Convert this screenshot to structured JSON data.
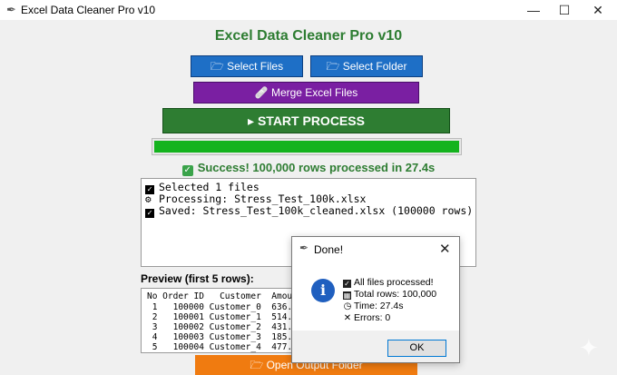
{
  "window": {
    "title": "Excel Data Cleaner Pro v10",
    "minimize_glyph": "—",
    "maximize_glyph": "☐",
    "close_glyph": "✕"
  },
  "app": {
    "heading": "Excel Data Cleaner Pro v10",
    "select_files_label": "🗁 Select Files",
    "select_folder_label": "🗁 Select Folder",
    "merge_label": "🩹 Merge Excel Files",
    "start_label": "▸ START PROCESS",
    "progress_percent": 100,
    "status_text": "Success! 100,000 rows processed in 27.4s",
    "log": [
      "Selected 1 files",
      "Processing: Stress_Test_100k.xlsx",
      "Saved: Stress_Test_100k_cleaned.xlsx (100000 rows)"
    ],
    "preview_label": "Preview (first 5 rows):",
    "preview_header": "No Order ID   Customer  Amount",
    "preview_rows": [
      " 1   100000 Customer_0  636.32",
      " 2   100001 Customer_1  514.47",
      " 3   100002 Customer_2  431.98",
      " 4   100003 Customer_3  185.15",
      " 5   100004 Customer_4  477.51"
    ],
    "open_output_label": "🗁 Open Output Folder"
  },
  "dialog": {
    "title": "Done!",
    "lines": [
      "All files processed!",
      "Total rows: 100,000",
      "Time: 27.4s",
      "Errors: 0"
    ],
    "ok_label": "OK"
  },
  "colors": {
    "accent_green": "#2e7d32",
    "button_blue": "#1e6fc6",
    "button_purple": "#7a1fa2",
    "button_orange": "#f07b10",
    "progress_green": "#14b31e"
  },
  "icons": [
    "feather-icon",
    "folder-icon",
    "bandage-icon",
    "play-icon",
    "checkmark-icon",
    "info-icon",
    "clock-icon",
    "close-icon",
    "sparkle-icon"
  ]
}
